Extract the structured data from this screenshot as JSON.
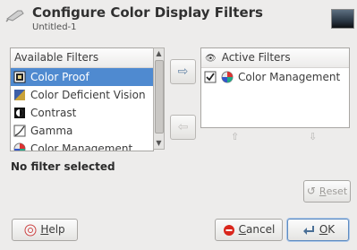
{
  "dialog": {
    "title": "Configure Color Display Filters",
    "subtitle": "Untitled-1"
  },
  "available": {
    "header": "Available Filters",
    "items": [
      {
        "label": "Color Proof",
        "icon": "color-proof-icon",
        "selected": true
      },
      {
        "label": "Color Deficient Vision",
        "icon": "color-deficient-vision-icon",
        "selected": false
      },
      {
        "label": "Contrast",
        "icon": "contrast-icon",
        "selected": false
      },
      {
        "label": "Gamma",
        "icon": "gamma-icon",
        "selected": false
      },
      {
        "label": "Color Management",
        "icon": "color-management-icon",
        "selected": false
      }
    ]
  },
  "active": {
    "header": "Active Filters",
    "items": [
      {
        "label": "Color Management",
        "checked": true,
        "icon": "color-management-icon"
      }
    ]
  },
  "status": "No filter selected",
  "buttons": {
    "reset_prefix": "",
    "reset_mnemonic": "R",
    "reset_rest": "eset",
    "help_mnemonic": "H",
    "help_rest": "elp",
    "cancel_mnemonic": "C",
    "cancel_rest": "ancel",
    "ok_mnemonic": "O",
    "ok_rest": "K"
  },
  "colors": {
    "selection": "#4f8ad0",
    "background": "#edeceb",
    "cancel_icon": "#d9261c"
  }
}
